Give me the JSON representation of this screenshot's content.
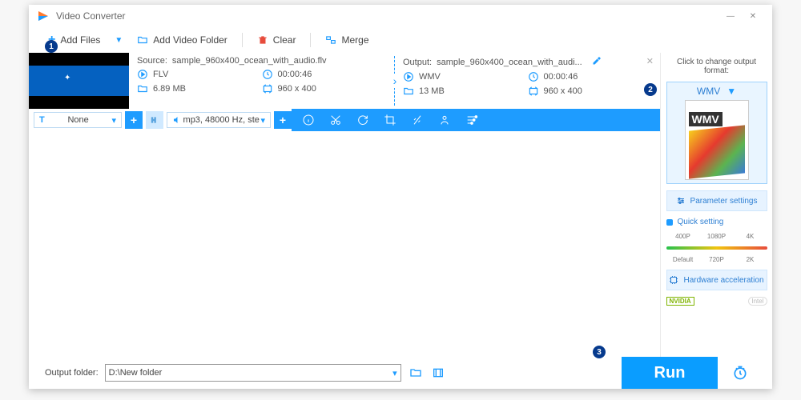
{
  "window": {
    "title": "Video Converter"
  },
  "toolbar": {
    "add_files": "Add Files",
    "add_folder": "Add Video Folder",
    "clear": "Clear",
    "merge": "Merge"
  },
  "clip": {
    "source_label": "Source:",
    "source_file": "sample_960x400_ocean_with_audio.flv",
    "src_format": "FLV",
    "src_duration": "00:00:46",
    "src_size": "6.89 MB",
    "src_res": "960 x 400",
    "output_label": "Output:",
    "output_file": "sample_960x400_ocean_with_audi...",
    "out_format": "WMV",
    "out_duration": "00:00:46",
    "out_size": "13 MB",
    "out_res": "960 x 400"
  },
  "audiostrip": {
    "subtitle": "None",
    "audio_track": "mp3, 48000 Hz, ste"
  },
  "sidebar": {
    "heading": "Click to change output format:",
    "format": "WMV",
    "preview_label": "WMV",
    "param_btn": "Parameter settings",
    "quick_title": "Quick setting",
    "qs_top": [
      "400P",
      "1080P",
      "4K"
    ],
    "qs_bottom": [
      "Default",
      "720P",
      "2K"
    ],
    "hw_btn": "Hardware acceleration",
    "nvidia": "NVIDIA",
    "intel": "Intel"
  },
  "bottom": {
    "out_label": "Output folder:",
    "out_path": "D:\\New folder",
    "run": "Run"
  },
  "callouts": {
    "one": "1",
    "two": "2",
    "three": "3"
  }
}
